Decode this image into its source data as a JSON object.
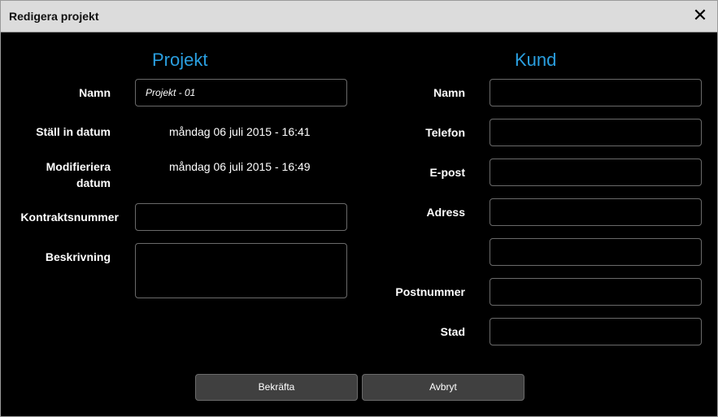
{
  "dialog": {
    "title": "Redigera projekt",
    "close_icon": "close-icon"
  },
  "project": {
    "heading": "Projekt",
    "name_label": "Namn",
    "name_value": "Projekt - 01",
    "created_label": "Ställ in datum",
    "created_value": "måndag 06 juli 2015 - 16:41",
    "modified_label_line1": "Modifieriera",
    "modified_label_line2": "datum",
    "modified_value": "måndag 06 juli 2015 - 16:49",
    "contract_label": "Kontraktsnummer",
    "contract_value": "",
    "description_label": "Beskrivning",
    "description_value": ""
  },
  "customer": {
    "heading": "Kund",
    "name_label": "Namn",
    "phone_label": "Telefon",
    "email_label": "E-post",
    "address_label": "Adress",
    "postal_label": "Postnummer",
    "city_label": "Stad"
  },
  "buttons": {
    "confirm": "Bekräfta",
    "cancel": "Avbryt"
  },
  "colors": {
    "accent": "#2a9fe0",
    "background": "#000000",
    "titlebar": "#dcdcdc"
  }
}
